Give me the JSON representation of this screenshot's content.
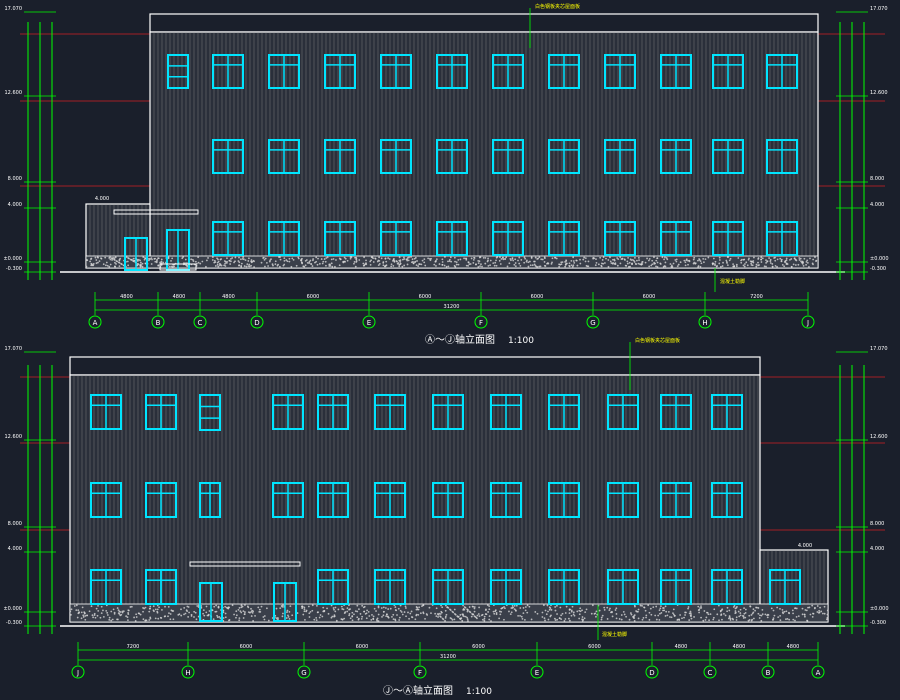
{
  "drawing": {
    "background_color": "#1a1f2b",
    "colors": {
      "outline": "#ffffff",
      "cladding": "#a0a0a0",
      "window": "#00e5ff",
      "dimension": "#00ff00",
      "level_line": "#ff2020",
      "annotation": "#ffff00"
    }
  },
  "elevation_top": {
    "title": "Ⓐ～Ⓙ轴立面图",
    "scale": "1:100",
    "axes": [
      "A",
      "B",
      "C",
      "D",
      "E",
      "F",
      "G",
      "H",
      "J"
    ],
    "spans": [
      "4800",
      "4800",
      "4800",
      "6000",
      "6000",
      "6000",
      "6000",
      "7200"
    ],
    "total": "31200",
    "levels_left": [
      "17.070",
      "12.600",
      "8.000",
      "4.000",
      "±0.000",
      "-0.300"
    ],
    "levels_right": [
      "17.070",
      "12.600",
      "8.000",
      "4.000",
      "±0.000",
      "-0.300"
    ],
    "note_roof": "白色钢板夹芯屋面板",
    "note_base": "混凝土勒脚",
    "canopy_label": "4.000"
  },
  "elevation_bottom": {
    "title": "Ⓙ～Ⓐ轴立面图",
    "scale": "1:100",
    "axes": [
      "J",
      "H",
      "G",
      "F",
      "E",
      "D",
      "C",
      "B",
      "A"
    ],
    "spans": [
      "7200",
      "6000",
      "6000",
      "6000",
      "6000",
      "4800",
      "4800",
      "4800"
    ],
    "total": "31200",
    "levels_left": [
      "17.070",
      "12.600",
      "8.000",
      "4.000",
      "±0.000",
      "-0.300"
    ],
    "levels_right": [
      "17.070",
      "12.600",
      "8.000",
      "4.000",
      "±0.000",
      "-0.300"
    ],
    "note_roof": "白色钢板夹芯屋面板",
    "note_base": "混凝土勒脚",
    "canopy_label": "4.000"
  }
}
